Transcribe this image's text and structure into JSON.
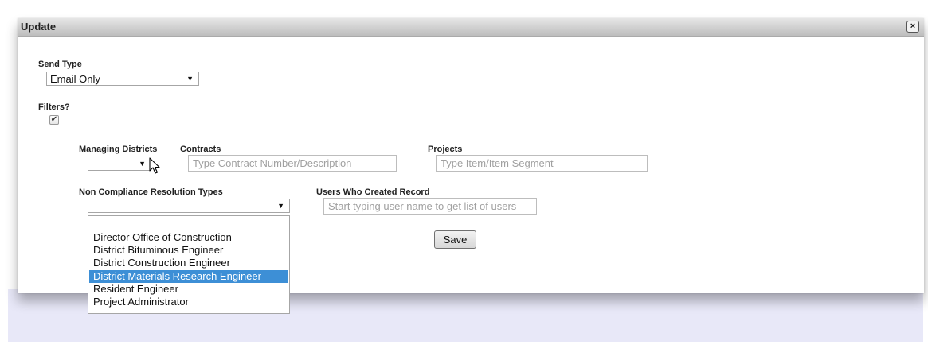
{
  "dialog": {
    "title": "Update",
    "close_label": "×"
  },
  "send_type": {
    "label": "Send Type",
    "value": "Email Only"
  },
  "filters": {
    "label": "Filters?",
    "checked": true,
    "check_glyph": "✔"
  },
  "managing_districts": {
    "label": "Managing Districts",
    "value": ""
  },
  "contracts": {
    "label": "Contracts",
    "placeholder": "Type Contract Number/Description"
  },
  "projects": {
    "label": "Projects",
    "placeholder": "Type Item/Item Segment"
  },
  "non_compliance": {
    "label": "Non Compliance Resolution Types",
    "value": "",
    "options": [
      "",
      "Director Office of Construction",
      "District Bituminous Engineer",
      "District Construction Engineer",
      "District Materials Research Engineer",
      "Resident Engineer",
      "Project Administrator"
    ],
    "highlighted": "District Materials Research Engineer"
  },
  "users_created": {
    "label": "Users Who Created Record",
    "placeholder": "Start typing user name to get list of users"
  },
  "save_label": "Save",
  "icons": {
    "dropdown_arrow": "chevron-down-icon",
    "cursor": "mouse-pointer-icon",
    "close": "close-icon",
    "check": "check-icon"
  }
}
